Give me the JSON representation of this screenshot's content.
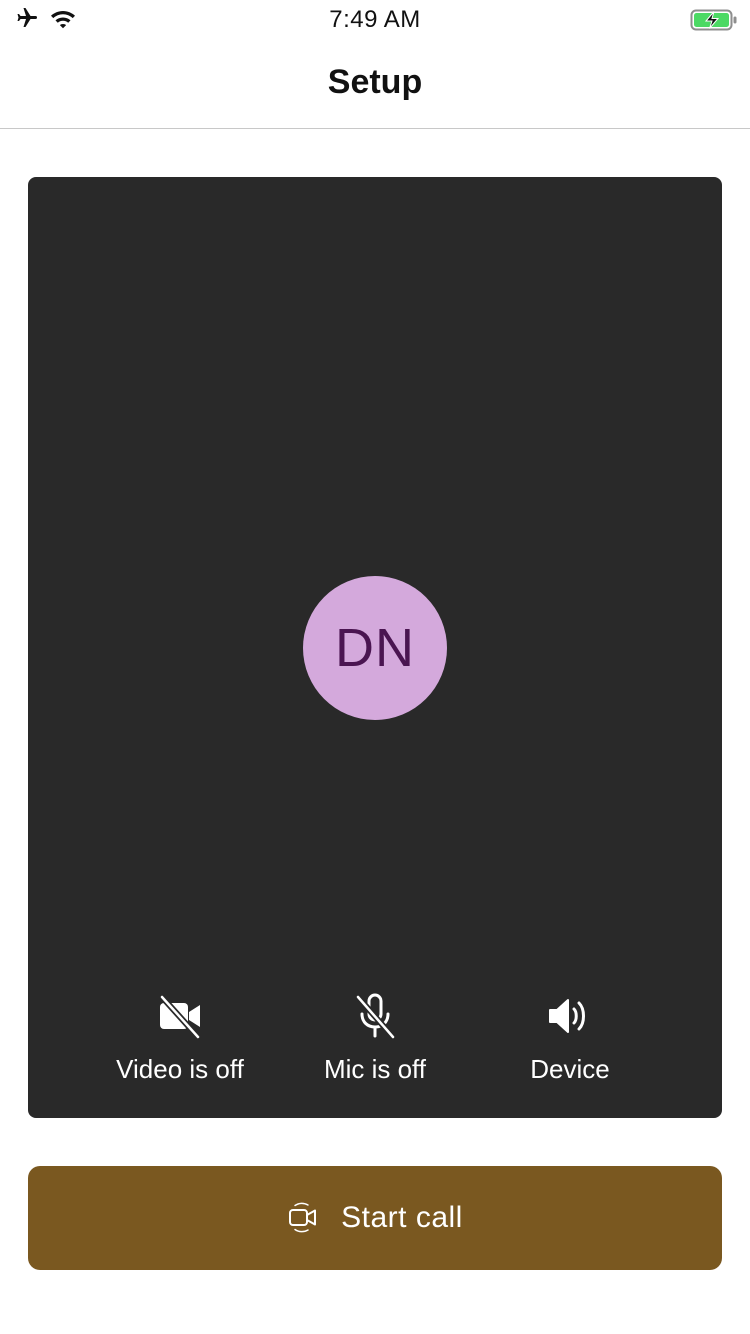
{
  "status_bar": {
    "time": "7:49 AM",
    "icons": [
      "airplane-icon",
      "wifi-icon",
      "battery-charging-icon"
    ]
  },
  "nav": {
    "title": "Setup"
  },
  "preview": {
    "avatar_initials": "DN",
    "avatar_color": "#d4a9dc",
    "avatar_text_color": "#4a1551",
    "background_color": "#292929"
  },
  "controls": {
    "video": {
      "label": "Video is off",
      "icon": "video-off-icon"
    },
    "mic": {
      "label": "Mic is off",
      "icon": "mic-off-icon"
    },
    "device": {
      "label": "Device",
      "icon": "speaker-icon"
    }
  },
  "start_call": {
    "label": "Start call",
    "icon": "start-call-icon",
    "color": "#7a5820"
  }
}
